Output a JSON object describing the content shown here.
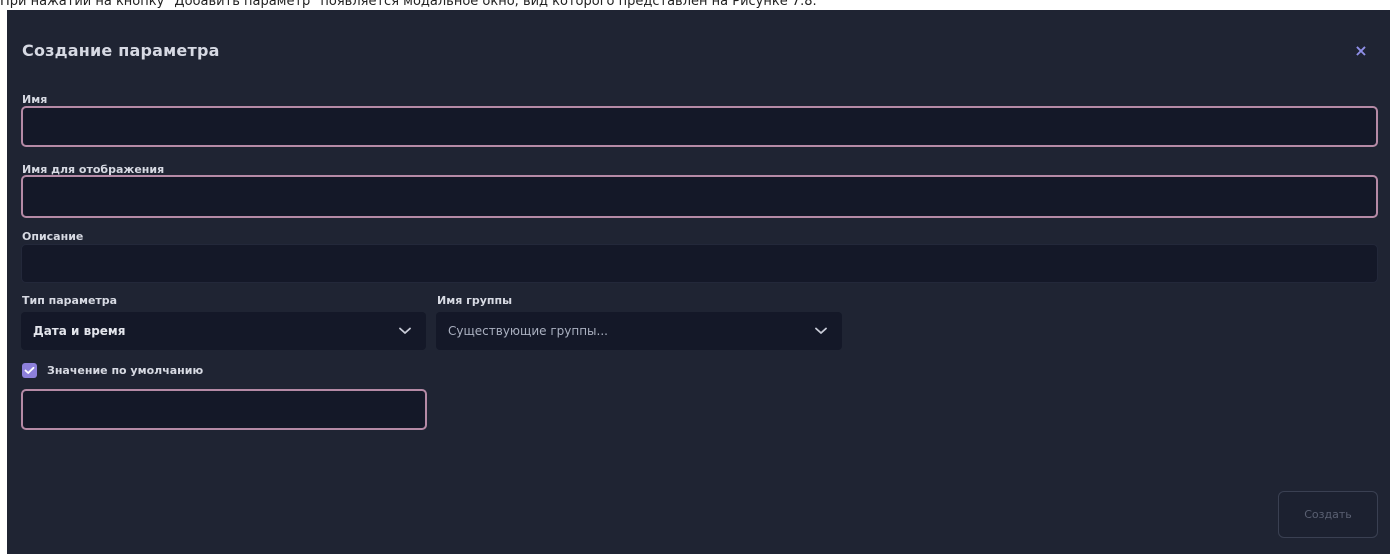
{
  "caption": "При нажатии на кнопку \"Добавить параметр\" появляется модальное окно, вид которого представлен на Рисунке 7.8.",
  "modal": {
    "title": "Создание параметра",
    "close_icon": "×"
  },
  "fields": {
    "name": {
      "label": "Имя",
      "value": ""
    },
    "display_name": {
      "label": "Имя для отображения",
      "value": ""
    },
    "description": {
      "label": "Описание",
      "value": ""
    },
    "param_type": {
      "label": "Тип параметра",
      "selected": "Дата и время"
    },
    "group_name": {
      "label": "Имя группы",
      "placeholder": "Существующие группы..."
    },
    "default_value": {
      "label": "Значение по умолчанию",
      "checked": true,
      "value": ""
    }
  },
  "buttons": {
    "create": "Создать"
  },
  "colors": {
    "modal_bg": "#1f2433",
    "input_bg": "#141828",
    "focus_border": "#b58aa6",
    "accent": "#8d80db"
  },
  "icons": {
    "close": "close-icon",
    "chevron": "chevron-down-icon",
    "check": "check-icon"
  }
}
